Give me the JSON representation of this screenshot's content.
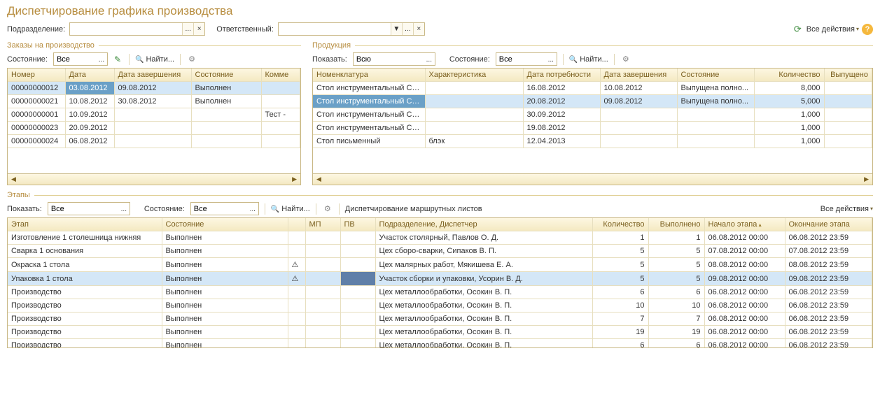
{
  "title": "Диспетчирование графика производства",
  "filters": {
    "department_label": "Подразделение:",
    "responsible_label": "Ответственный:",
    "btn_dots": "...",
    "btn_clear": "×",
    "btn_drop": "▼"
  },
  "header_actions": {
    "all_actions": "Все действия"
  },
  "orders": {
    "panel_title": "Заказы на производство",
    "state_label": "Состояние:",
    "state_value": "Все",
    "find_label": "Найти...",
    "columns": [
      "Номер",
      "Дата",
      "Дата завершения",
      "Состояние",
      "Комме"
    ],
    "rows": [
      {
        "num": "00000000012",
        "date": "03.08.2012",
        "end": "09.08.2012",
        "state": "Выполнен",
        "comment": "",
        "sel": true
      },
      {
        "num": "00000000021",
        "date": "10.08.2012",
        "end": "30.08.2012",
        "state": "Выполнен",
        "comment": ""
      },
      {
        "num": "00000000001",
        "date": "10.09.2012",
        "end": "",
        "state": "",
        "comment": "Тест -"
      },
      {
        "num": "00000000023",
        "date": "20.09.2012",
        "end": "",
        "state": "",
        "comment": ""
      },
      {
        "num": "00000000024",
        "date": "06.08.2012",
        "end": "",
        "state": "",
        "comment": ""
      }
    ]
  },
  "products": {
    "panel_title": "Продукция",
    "show_label": "Показать:",
    "show_value": "Всю",
    "state_label": "Состояние:",
    "state_value": "Все",
    "find_label": "Найти...",
    "columns": [
      "Номенклатура",
      "Характеристика",
      "Дата потребности",
      "Дата завершения",
      "Состояние",
      "Количество",
      "Выпущено"
    ],
    "rows": [
      {
        "nom": "Стол инструментальный СИ...",
        "char": "",
        "need": "16.08.2012",
        "end": "10.08.2012",
        "state": "Выпущена полно...",
        "qty": "8,000",
        "out": ""
      },
      {
        "nom": "Стол инструментальный СИ...",
        "char": "",
        "need": "20.08.2012",
        "end": "09.08.2012",
        "state": "Выпущена полно...",
        "qty": "5,000",
        "out": "",
        "sel": true
      },
      {
        "nom": "Стол инструментальный СИ...",
        "char": "",
        "need": "30.09.2012",
        "end": "",
        "state": "",
        "qty": "1,000",
        "out": ""
      },
      {
        "nom": "Стол инструментальный СИ...",
        "char": "",
        "need": "19.08.2012",
        "end": "",
        "state": "",
        "qty": "1,000",
        "out": ""
      },
      {
        "nom": "Стол письменный",
        "char": "блэк",
        "need": "12.04.2013",
        "end": "",
        "state": "",
        "qty": "1,000",
        "out": ""
      }
    ]
  },
  "stages": {
    "panel_title": "Этапы",
    "show_label": "Показать:",
    "show_value": "Все",
    "state_label": "Состояние:",
    "state_value": "Все",
    "find_label": "Найти...",
    "dispatch_link": "Диспетчирование маршрутных листов",
    "all_actions": "Все действия",
    "columns": [
      "Этап",
      "Состояние",
      "",
      "МП",
      "ПВ",
      "Подразделение, Диспетчер",
      "Количество",
      "Выполнено",
      "Начало этапа",
      "Окончание этапа"
    ],
    "rows": [
      {
        "stage": "Изготовление 1 столешница нижняя",
        "state": "Выполнен",
        "warn": false,
        "mp": "",
        "pv": "",
        "dept": "Участок столярный, Павлов О. Д.",
        "qty": "1",
        "done": "1",
        "start": "06.08.2012 00:00",
        "end": "06.08.2012 23:59"
      },
      {
        "stage": "Сварка 1 основания",
        "state": "Выполнен",
        "warn": false,
        "mp": "",
        "pv": "",
        "dept": "Цех сборо-сварки, Сипаков В. П.",
        "qty": "5",
        "done": "5",
        "start": "07.08.2012 00:00",
        "end": "07.08.2012 23:59"
      },
      {
        "stage": "Окраска 1 стола",
        "state": "Выполнен",
        "warn": true,
        "mp": "",
        "pv": "",
        "dept": "Цех малярных работ, Мякишева Е. А.",
        "qty": "5",
        "done": "5",
        "start": "08.08.2012 00:00",
        "end": "08.08.2012 23:59"
      },
      {
        "stage": "Упаковка 1 стола",
        "state": "Выполнен",
        "warn": true,
        "mp": "",
        "pv": "",
        "dept": "Участок сборки и упаковки, Усорин В. Д.",
        "qty": "5",
        "done": "5",
        "start": "09.08.2012 00:00",
        "end": "09.08.2012 23:59",
        "sel": true
      },
      {
        "stage": "Производство",
        "state": "Выполнен",
        "warn": false,
        "mp": "",
        "pv": "",
        "dept": "Цех металлообработки, Осокин В. П.",
        "qty": "6",
        "done": "6",
        "start": "06.08.2012 00:00",
        "end": "06.08.2012 23:59"
      },
      {
        "stage": "Производство",
        "state": "Выполнен",
        "warn": false,
        "mp": "",
        "pv": "",
        "dept": "Цех металлообработки, Осокин В. П.",
        "qty": "10",
        "done": "10",
        "start": "06.08.2012 00:00",
        "end": "06.08.2012 23:59"
      },
      {
        "stage": "Производство",
        "state": "Выполнен",
        "warn": false,
        "mp": "",
        "pv": "",
        "dept": "Цех металлообработки, Осокин В. П.",
        "qty": "7",
        "done": "7",
        "start": "06.08.2012 00:00",
        "end": "06.08.2012 23:59"
      },
      {
        "stage": "Производство",
        "state": "Выполнен",
        "warn": false,
        "mp": "",
        "pv": "",
        "dept": "Цех металлообработки, Осокин В. П.",
        "qty": "19",
        "done": "19",
        "start": "06.08.2012 00:00",
        "end": "06.08.2012 23:59"
      },
      {
        "stage": "Производство",
        "state": "Выполнен",
        "warn": false,
        "mp": "",
        "pv": "",
        "dept": "Цех металлообработки, Осокин В. П.",
        "qty": "6",
        "done": "6",
        "start": "06.08.2012 00:00",
        "end": "06.08.2012 23:59"
      }
    ]
  }
}
